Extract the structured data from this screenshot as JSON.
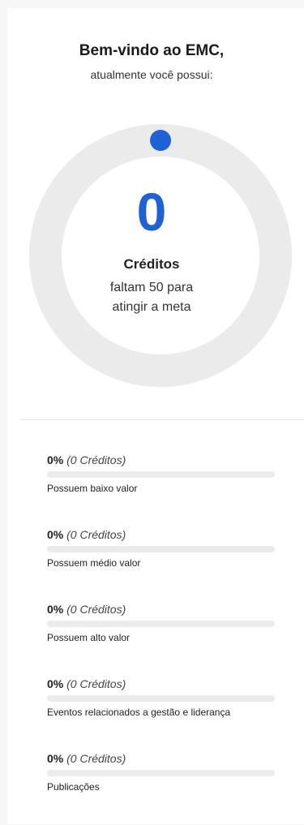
{
  "welcome": {
    "title": "Bem-vindo ao EMC,",
    "subtitle": "atualmente você possui:"
  },
  "summary": {
    "credits_value": "0",
    "credits_label": "Créditos",
    "remaining_text": "faltam 50 para atingir a meta",
    "progress_fraction": 0
  },
  "stats": [
    {
      "percent": "0%",
      "credits": "(0 Créditos)",
      "description": "Possuem baixo valor",
      "progress_fraction": 0
    },
    {
      "percent": "0%",
      "credits": "(0 Créditos)",
      "description": "Possuem médio valor",
      "progress_fraction": 0
    },
    {
      "percent": "0%",
      "credits": "(0 Créditos)",
      "description": "Possuem alto valor",
      "progress_fraction": 0
    },
    {
      "percent": "0%",
      "credits": "(0 Créditos)",
      "description": "Eventos relacionados a gestão e liderança",
      "progress_fraction": 0
    },
    {
      "percent": "0%",
      "credits": "(0 Créditos)",
      "description": "Publicações",
      "progress_fraction": 0
    }
  ],
  "colors": {
    "accent": "#1f62d6",
    "track": "#ebebeb"
  }
}
